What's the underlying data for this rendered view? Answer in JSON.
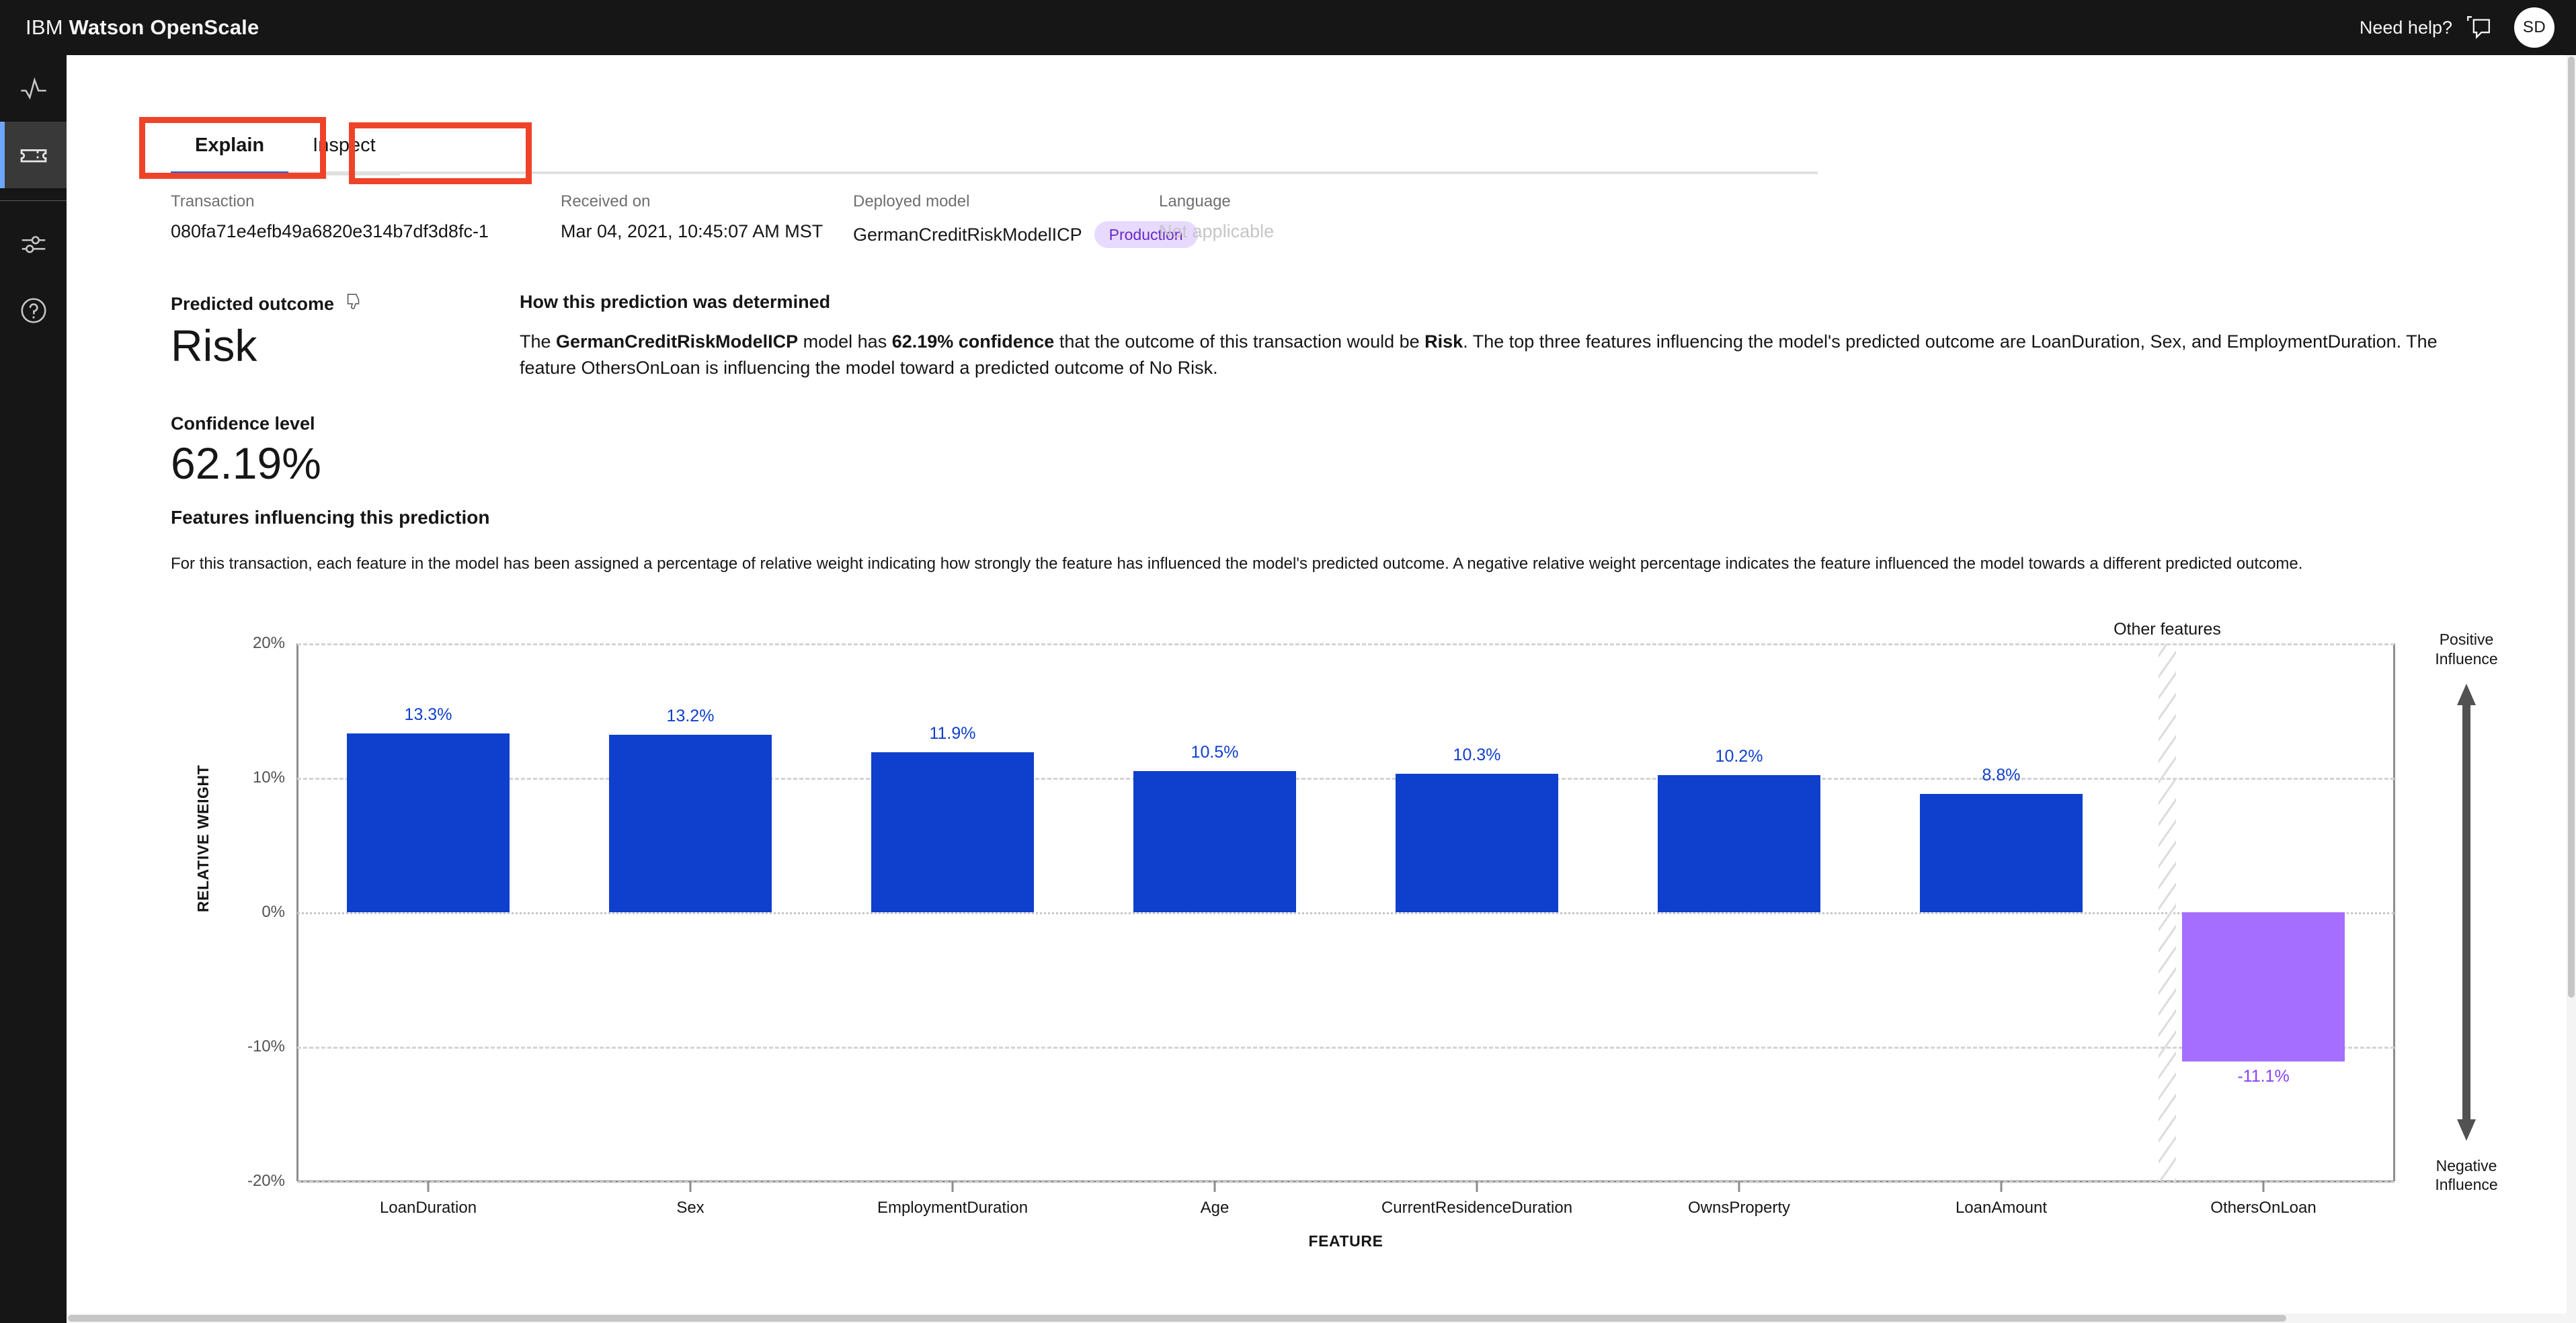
{
  "app": {
    "brand_thin": "IBM",
    "brand_bold": "Watson OpenScale",
    "need_help": "Need help?",
    "avatar_initials": "SD"
  },
  "sidebar": {
    "items": [
      {
        "name": "monitors",
        "icon": "pulse-icon"
      },
      {
        "name": "transactions",
        "icon": "ticket-icon"
      },
      {
        "name": "configuration",
        "icon": "sliders-icon"
      },
      {
        "name": "help",
        "icon": "help-icon"
      }
    ]
  },
  "tabs": [
    {
      "label": "Explain",
      "selected": true
    },
    {
      "label": "Inspect",
      "selected": false
    }
  ],
  "meta": {
    "transaction_label": "Transaction",
    "transaction_value": "080fa71e4efb49a6820e314b7df3d8fc-1",
    "received_label": "Received on",
    "received_value": "Mar 04, 2021, 10:45:07 AM MST",
    "model_label": "Deployed model",
    "model_value": "GermanCreditRiskModelICP",
    "model_tag": "Production",
    "language_label": "Language",
    "language_value": "Not applicable"
  },
  "prediction": {
    "outcome_label": "Predicted outcome",
    "outcome_value": "Risk",
    "confidence_label": "Confidence level",
    "confidence_value": "62.19%"
  },
  "how": {
    "title": "How this prediction was determined",
    "text_1": "The ",
    "model_name": "GermanCreditRiskModelICP",
    "text_2": " model has ",
    "confidence": "62.19% confidence",
    "text_3": " that the outcome of this transaction would be ",
    "outcome": "Risk",
    "text_4": ". The top three features influencing the model's predicted outcome are LoanDuration, Sex, and EmploymentDuration. The feature OthersOnLoan is influencing the model toward a predicted outcome of No Risk."
  },
  "features_section": {
    "title": "Features influencing this prediction",
    "description": "For this transaction, each feature in the model has been assigned a percentage of relative weight indicating how strongly the feature has influenced the model's predicted outcome. A negative relative weight percentage indicates the feature influenced the model towards a different predicted outcome."
  },
  "chart_data": {
    "type": "bar",
    "title": "",
    "xlabel": "FEATURE",
    "ylabel": "RELATIVE WEIGHT",
    "ylim": [
      -20,
      20
    ],
    "yticks": [
      "20%",
      "10%",
      "0%",
      "-10%",
      "-20%"
    ],
    "ytick_values": [
      20,
      10,
      0,
      -10,
      -20
    ],
    "grid": true,
    "categories": [
      "LoanDuration",
      "Sex",
      "EmploymentDuration",
      "Age",
      "CurrentResidenceDuration",
      "OwnsProperty",
      "LoanAmount",
      "OthersOnLoan"
    ],
    "values": [
      13.3,
      13.2,
      11.9,
      10.5,
      10.3,
      10.2,
      8.8,
      -11.1
    ],
    "data_labels": [
      "13.3%",
      "13.2%",
      "11.9%",
      "10.5%",
      "10.3%",
      "10.2%",
      "8.8%",
      "-11.1%"
    ],
    "positive_color": "#0f3fcd",
    "negative_color": "#a56eff",
    "other_features_label": "Other features",
    "other_features_divider_after_index": 6,
    "legend": {
      "positive": "Positive\nInfluence",
      "positive_line1": "Positive",
      "positive_line2": "Influence",
      "negative_line1": "Negative",
      "negative_line2": "Influence"
    }
  }
}
